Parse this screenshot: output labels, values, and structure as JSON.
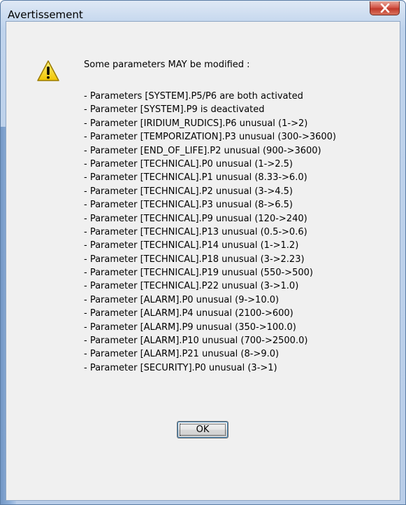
{
  "window": {
    "title": "Avertissement",
    "close_label": "X"
  },
  "dialog": {
    "heading": "Some parameters MAY be modified :",
    "icon": "warning-icon",
    "lines": [
      "- Parameters [SYSTEM].P5/P6 are both activated",
      "- Parameter [SYSTEM].P9 is deactivated",
      "- Parameter [IRIDIUM_RUDICS].P6 unusual (1->2)",
      "- Parameter [TEMPORIZATION].P3 unusual (300->3600)",
      "- Parameter [END_OF_LIFE].P2 unusual (900->3600)",
      "- Parameter [TECHNICAL].P0 unusual (1->2.5)",
      "- Parameter [TECHNICAL].P1 unusual (8.33->6.0)",
      "- Parameter [TECHNICAL].P2 unusual (3->4.5)",
      "- Parameter [TECHNICAL].P3 unusual (8->6.5)",
      "- Parameter [TECHNICAL].P9 unusual (120->240)",
      "- Parameter [TECHNICAL].P13 unusual (0.5->0.6)",
      "- Parameter [TECHNICAL].P14 unusual (1->1.2)",
      "- Parameter [TECHNICAL].P18 unusual (3->2.23)",
      "- Parameter [TECHNICAL].P19 unusual (550->500)",
      "- Parameter [TECHNICAL].P22 unusual (3->1.0)",
      "- Parameter [ALARM].P0 unusual (9->10.0)",
      "- Parameter [ALARM].P4 unusual (2100->600)",
      "- Parameter [ALARM].P9 unusual (350->100.0)",
      "- Parameter [ALARM].P10 unusual (700->2500.0)",
      "- Parameter [ALARM].P21 unusual (8->9.0)",
      "- Parameter [SECURITY].P0 unusual (3->1)"
    ],
    "ok_label": "OK"
  },
  "colors": {
    "frame": "#bfd3ec",
    "client": "#f0f0f0",
    "close": "#c0392b",
    "warning": "#f5d000"
  }
}
